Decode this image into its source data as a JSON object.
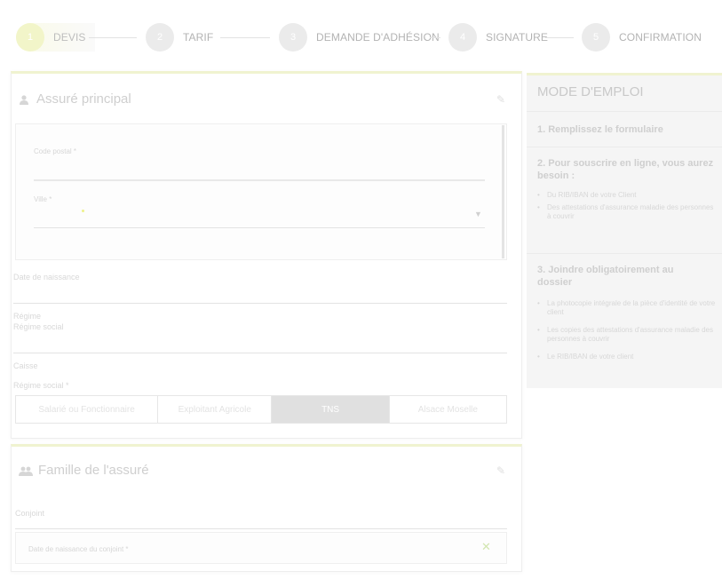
{
  "stepper": {
    "steps": [
      {
        "num": "1",
        "label": "DEVIS"
      },
      {
        "num": "2",
        "label": "TARIF"
      },
      {
        "num": "3",
        "label": "DEMANDE D'ADHÉSION"
      },
      {
        "num": "4",
        "label": "SIGNATURE"
      },
      {
        "num": "5",
        "label": "CONFIRMATION"
      }
    ],
    "active_step": 1
  },
  "assure": {
    "title": "Assuré principal",
    "postal_label": "Code postal *",
    "ville_label": "Ville *",
    "date_label": "Date de naissance",
    "regime_label": "Régime",
    "regime_sub": "Régime social",
    "caisse_label": "Caisse",
    "regime_obligatoire_label": "Régime social *",
    "regimes": [
      "Salarié ou Fonctionnaire",
      "Exploitant Agricole",
      "TNS",
      "Alsace Moselle"
    ],
    "selected_regime": "TNS"
  },
  "famille": {
    "title": "Famille de l'assuré",
    "conjoint_label": "Conjoint",
    "conjoint_date_label": "Date de naissance du conjoint *"
  },
  "mode_emploi": {
    "title": "MODE D'EMPLOI",
    "step1": "1. Remplissez le formulaire",
    "step2": "2. Pour souscrire en ligne, vous aurez besoin :",
    "step2_items": [
      "Du RIB/IBAN de votre Client",
      "Des attestations d'assurance maladie des personnes à couvrir"
    ],
    "step3": "3. Joindre obligatoirement au dossier",
    "step3_items": [
      "La photocopie intégrale de la pièce d'identité de votre client",
      "Les copies des attestations d'assurance maladie des personnes à couvrir",
      "Le RIB/IBAN de votre client"
    ]
  },
  "colors": {
    "accent": "#f0f3d0",
    "selected_segment": "#e0e0e0",
    "panel_bg": "#f5f5f5"
  }
}
